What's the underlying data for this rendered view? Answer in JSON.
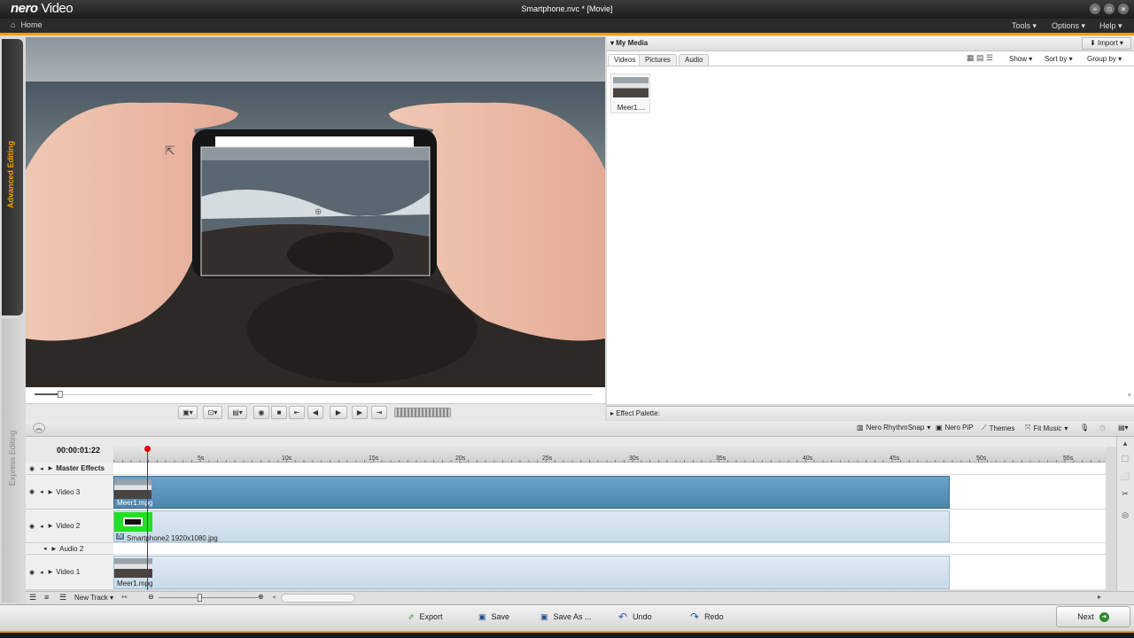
{
  "app": {
    "brand": "nero",
    "product": "Video",
    "window_title": "Smartphone.nvc * [Movie]"
  },
  "menubar": {
    "home": "Home",
    "tools": "Tools",
    "options": "Options",
    "help": "Help"
  },
  "side_tabs": {
    "advanced": "Advanced Editing",
    "express": "Express Editing"
  },
  "media": {
    "title": "My Media",
    "import": "Import",
    "tabs": [
      "Videos",
      "Pictures",
      "Audio"
    ],
    "show": "Show",
    "sort_by": "Sort by",
    "group_by": "Group by",
    "items": [
      {
        "name": "Meer1...."
      }
    ]
  },
  "effect_palette": "Effect Palette:",
  "timeline_toolbar": {
    "rhythmsnap": "Nero RhythmSnap",
    "pip": "Nero PiP",
    "themes": "Themes",
    "fit_music": "Fit Music"
  },
  "timecode": "00:00:01:22",
  "ruler_ticks": [
    "5s",
    "10s",
    "15s",
    "20s",
    "25s",
    "30s",
    "35s",
    "40s",
    "45s",
    "50s",
    "55s"
  ],
  "tracks": {
    "master": "Master Effects",
    "video3": "Video 3",
    "video2": "Video 2",
    "audio2": "Audio 2",
    "video1": "Video 1"
  },
  "clips": {
    "v3": "Meer1.mpg",
    "v2": "Smartphone2 1920x1080.jpg",
    "v2_fx": "fx",
    "v1": "Meer1.mpg"
  },
  "bottom": {
    "new_track": "New Track"
  },
  "footer": {
    "export": "Export",
    "save": "Save",
    "save_as": "Save As ...",
    "undo": "Undo",
    "redo": "Redo",
    "next": "Next"
  },
  "colors": {
    "accent": "#f0a000",
    "clip_blue": "#5a93ba",
    "green_screen": "#22e022"
  }
}
